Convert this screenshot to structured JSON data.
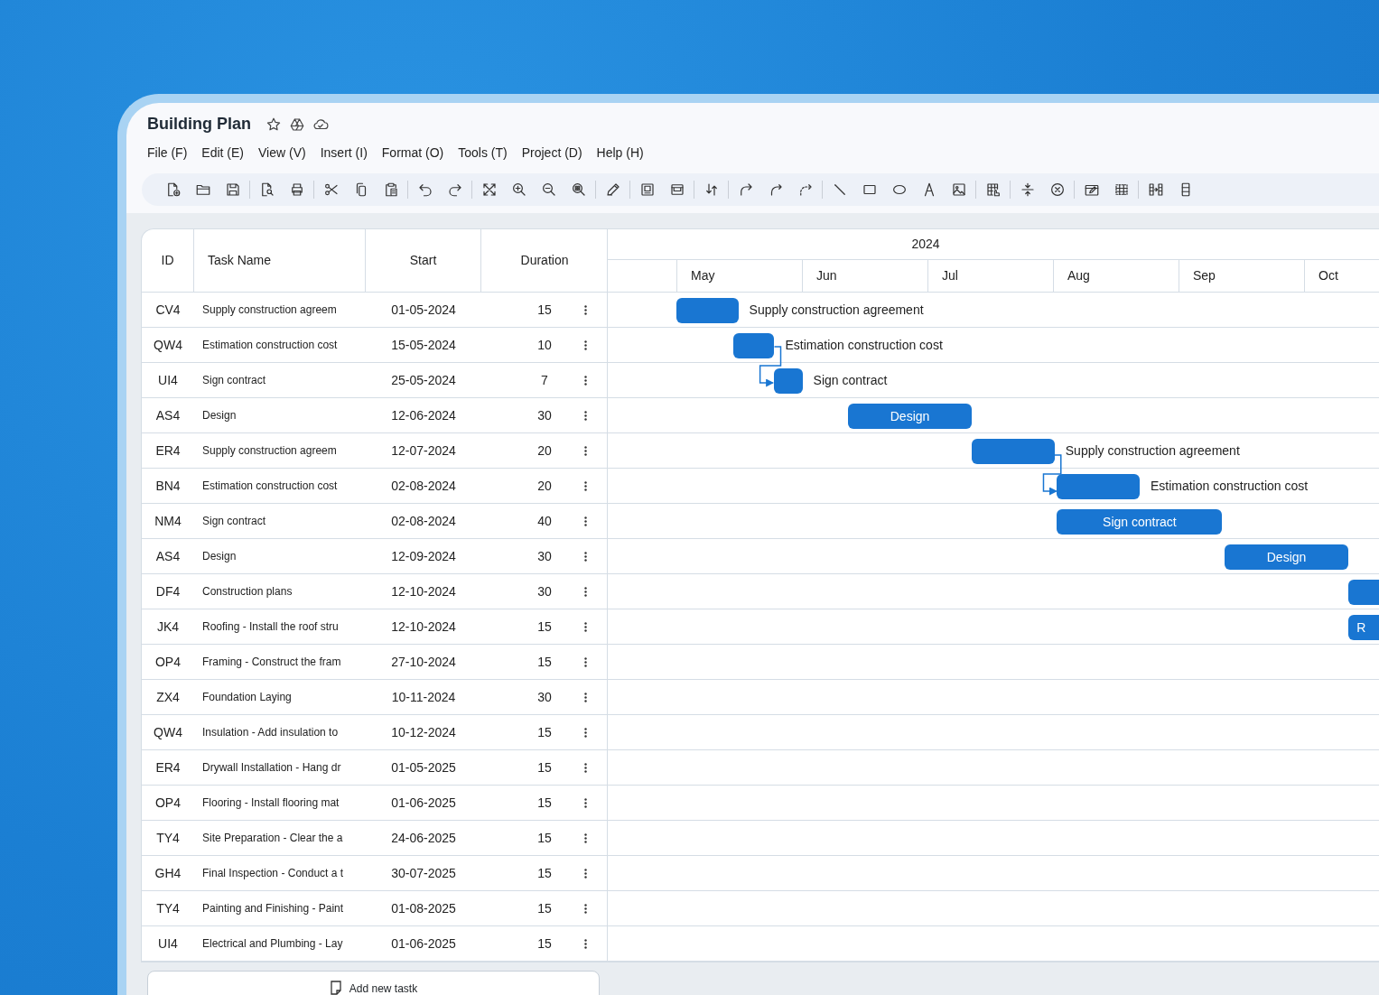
{
  "title": "Building Plan",
  "menu": [
    "File (F)",
    "Edit (E)",
    "View (V)",
    "Insert (I)",
    "Format (O)",
    "Tools (T)",
    "Project (D)",
    "Help (H)"
  ],
  "table": {
    "columns": [
      "ID",
      "Task Name",
      "Start",
      "Duration"
    ],
    "rows": [
      {
        "id": "CV4",
        "task": "Supply construction agreem",
        "start": "01-05-2024",
        "duration": "15"
      },
      {
        "id": "QW4",
        "task": "Estimation construction cost",
        "start": "15-05-2024",
        "duration": "10"
      },
      {
        "id": "UI4",
        "task": "Sign contract",
        "start": "25-05-2024",
        "duration": "7"
      },
      {
        "id": "AS4",
        "task": "Design",
        "start": "12-06-2024",
        "duration": "30"
      },
      {
        "id": "ER4",
        "task": "Supply construction agreem",
        "start": "12-07-2024",
        "duration": "20"
      },
      {
        "id": "BN4",
        "task": "Estimation construction cost",
        "start": "02-08-2024",
        "duration": "20"
      },
      {
        "id": "NM4",
        "task": "Sign contract",
        "start": "02-08-2024",
        "duration": "40"
      },
      {
        "id": "AS4",
        "task": "Design",
        "start": "12-09-2024",
        "duration": "30"
      },
      {
        "id": "DF4",
        "task": "Construction plans",
        "start": "12-10-2024",
        "duration": "30"
      },
      {
        "id": "JK4",
        "task": "Roofing - Install the roof stru",
        "start": "12-10-2024",
        "duration": "15"
      },
      {
        "id": "OP4",
        "task": "Framing - Construct the fram",
        "start": "27-10-2024",
        "duration": "15"
      },
      {
        "id": "ZX4",
        "task": "Foundation Laying",
        "start": "10-11-2024",
        "duration": "30"
      },
      {
        "id": "QW4",
        "task": "Insulation - Add insulation to",
        "start": "10-12-2024",
        "duration": "15"
      },
      {
        "id": "ER4",
        "task": "Drywall Installation - Hang dr",
        "start": "01-05-2025",
        "duration": "15"
      },
      {
        "id": "OP4",
        "task": "Flooring - Install flooring mat",
        "start": "01-06-2025",
        "duration": "15"
      },
      {
        "id": "TY4",
        "task": "Site Preparation - Clear the a",
        "start": "24-06-2025",
        "duration": "15"
      },
      {
        "id": "GH4",
        "task": "Final Inspection - Conduct a t",
        "start": "30-07-2025",
        "duration": "15"
      },
      {
        "id": "TY4",
        "task": "Painting and Finishing - Paint",
        "start": "01-08-2025",
        "duration": "15"
      },
      {
        "id": "UI4",
        "task": "Electrical and Plumbing - Lay",
        "start": "01-06-2025",
        "duration": "15"
      }
    ]
  },
  "gantt": {
    "year": "2024",
    "months": [
      "May",
      "Jun",
      "Jul",
      "Aug",
      "Sep",
      "Oct"
    ],
    "bars": [
      {
        "kind": "outside",
        "label": "Supply construction agreement",
        "linked": false
      },
      {
        "kind": "outside",
        "label": "Estimation construction cost",
        "linked": false
      },
      {
        "kind": "outside",
        "label": "Sign contract",
        "linked": true
      },
      {
        "kind": "inside",
        "label": "Design",
        "linked": false
      },
      {
        "kind": "outside",
        "label": "Supply construction agreement",
        "linked": false
      },
      {
        "kind": "outside",
        "label": "Estimation construction cost",
        "linked": true
      },
      {
        "kind": "inside",
        "label": "Sign contract",
        "linked": false
      },
      {
        "kind": "inside",
        "label": "Design",
        "linked": false
      },
      {
        "kind": "plain",
        "linked": false
      },
      {
        "kind": "clipped",
        "label": "R",
        "linked": false
      }
    ]
  },
  "add_button": "Add new tastk"
}
